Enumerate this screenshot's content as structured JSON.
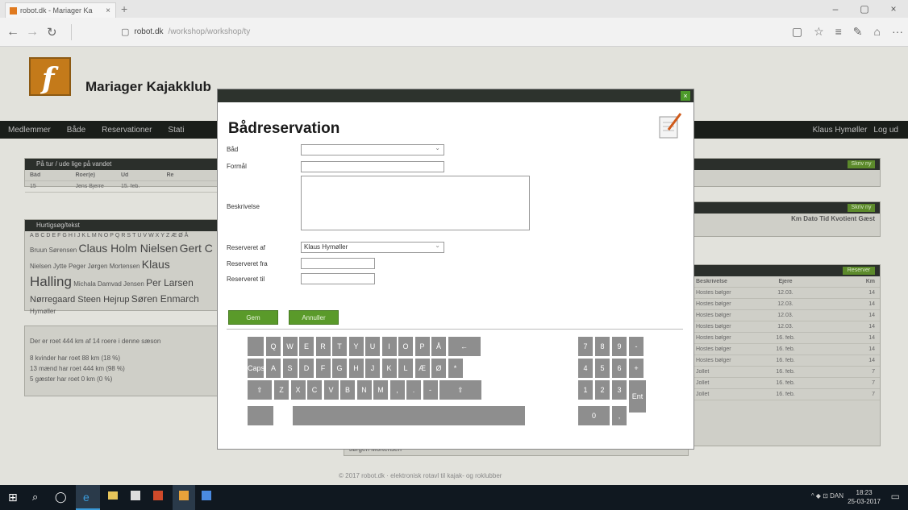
{
  "browser": {
    "tab_title": "robot.dk - Mariager Ka",
    "tab_close": "×",
    "new_tab": "+",
    "window_buttons": [
      "–",
      "▢",
      "×"
    ],
    "url_host": "robot.dk",
    "url_rest": "/workshop/workshop/ty",
    "nav": {
      "back": "←",
      "forward": "→",
      "refresh": "↻"
    },
    "tools": [
      "☆",
      "≡",
      "✎",
      "⌂",
      "···"
    ]
  },
  "site": {
    "logo_letter": "f",
    "title": "Mariager Kajakklub",
    "nav_left": [
      "Medlemmer",
      "Både",
      "Reservationer",
      "Stati"
    ],
    "nav_right": [
      "Klaus Hymøller",
      "Log ud"
    ],
    "panels": {
      "fatur_header": "På tur / ude lige på vandet",
      "fatur_cols": [
        "Båd",
        "Roer(e)",
        "Ud",
        "Re"
      ],
      "fatur_row": [
        "15",
        "Jens Bjerre",
        "15. feb.",
        ""
      ],
      "tags_header": "Hurtigsøg/tekst",
      "tags_line1": "ABCDEFGHIJKLMNOPQRSTUVWXYZÆØÅ",
      "tags_small1": "Bruun Sørensen",
      "tags_big1": "Claus Holm Nielsen",
      "tags_big1b": "Gert C",
      "tags_small2": "Nielsen  Jytte Peger  Jørgen Mortensen",
      "tags_big2": "Klaus",
      "tags_big3": "Halling",
      "tags_small3": "Michala Damvad Jensen",
      "tags_big4": "Per Larsen",
      "tags_small4": "Nørregaard  Steen Hejrup",
      "tags_big5": "Søren Enmarch",
      "tags_small5": "Hymøller",
      "stats1": "Der er roet 444 km af 14 roere i denne sæson",
      "stats2": "8 kvinder har roet 88 km (18 %)",
      "stats3": "13 mænd har roet 444 km (98 %)",
      "stats4": "5 gæster har roet 0 km (0 %)",
      "right1_btn": "Skriv ny",
      "right2_btn": "Skriv ny",
      "right2_cols": "Km  Dato  Tid  Kvotient  Gæst",
      "right3_btn": "Reserver",
      "right3_cols": [
        "Beskrivelse",
        "Ejere",
        "Km"
      ],
      "right3_rows": [
        [
          "Hostes bølger",
          "12.03.",
          "14"
        ],
        [
          "Hostes bølger",
          "12.03.",
          "14"
        ],
        [
          "Hostes bølger",
          "12.03.",
          "14"
        ],
        [
          "Hostes bølger",
          "12.03.",
          "14"
        ],
        [
          "Hostes bølger",
          "16. feb.",
          "14"
        ],
        [
          "Hostes bølger",
          "16. feb.",
          "14"
        ],
        [
          "Hostes bølger",
          "16. feb.",
          "14"
        ],
        [
          "Jollet",
          "16. feb.",
          "7"
        ],
        [
          "Jollet",
          "16. feb.",
          "7"
        ],
        [
          "Jollet",
          "16. feb.",
          "7"
        ]
      ],
      "behind_row": "Jørgen Mortensen"
    },
    "footer": "© 2017 robot.dk · elektronisk rotavl til kajak- og roklubber"
  },
  "modal": {
    "title": "Bådreservation",
    "labels": {
      "boat": "Båd",
      "purpose": "Formål",
      "description": "Beskrivelse",
      "reserved_by": "Reserveret af",
      "reserved_from": "Reserveret fra",
      "reserved_to": "Reserveret til"
    },
    "values": {
      "boat": "",
      "purpose": "",
      "description": "",
      "reserved_by": "Klaus Hymøller",
      "reserved_from": "",
      "reserved_to": ""
    },
    "buttons": {
      "save": "Gem",
      "cancel": "Annuller"
    },
    "close": "×"
  },
  "keyboard": {
    "row1": [
      "Q",
      "W",
      "E",
      "R",
      "T",
      "Y",
      "U",
      "I",
      "O",
      "P",
      "Å",
      "←"
    ],
    "row2": [
      "Caps",
      "A",
      "S",
      "D",
      "F",
      "G",
      "H",
      "J",
      "K",
      "L",
      "Æ",
      "Ø",
      "*"
    ],
    "row3": [
      "⇧",
      "Z",
      "X",
      "C",
      "V",
      "B",
      "N",
      "M",
      ",",
      ".",
      "-",
      "⇧"
    ],
    "numpad_row1": [
      "7",
      "8",
      "9",
      "-"
    ],
    "numpad_row2": [
      "4",
      "5",
      "6",
      "+"
    ],
    "numpad_row3": [
      "1",
      "2",
      "3"
    ],
    "numpad_enter": "Ent",
    "numpad_zero": "0",
    "numpad_dot": ","
  },
  "taskbar": {
    "tray": "^ ◆ ⊡ DAN",
    "time": "18:23",
    "date": "25-03-2017"
  },
  "colors": {
    "accent_green": "#5a9a2a",
    "dark_bar": "#2d332d",
    "logo_orange": "#c47a1a",
    "key_gray": "#8e8e8e"
  }
}
